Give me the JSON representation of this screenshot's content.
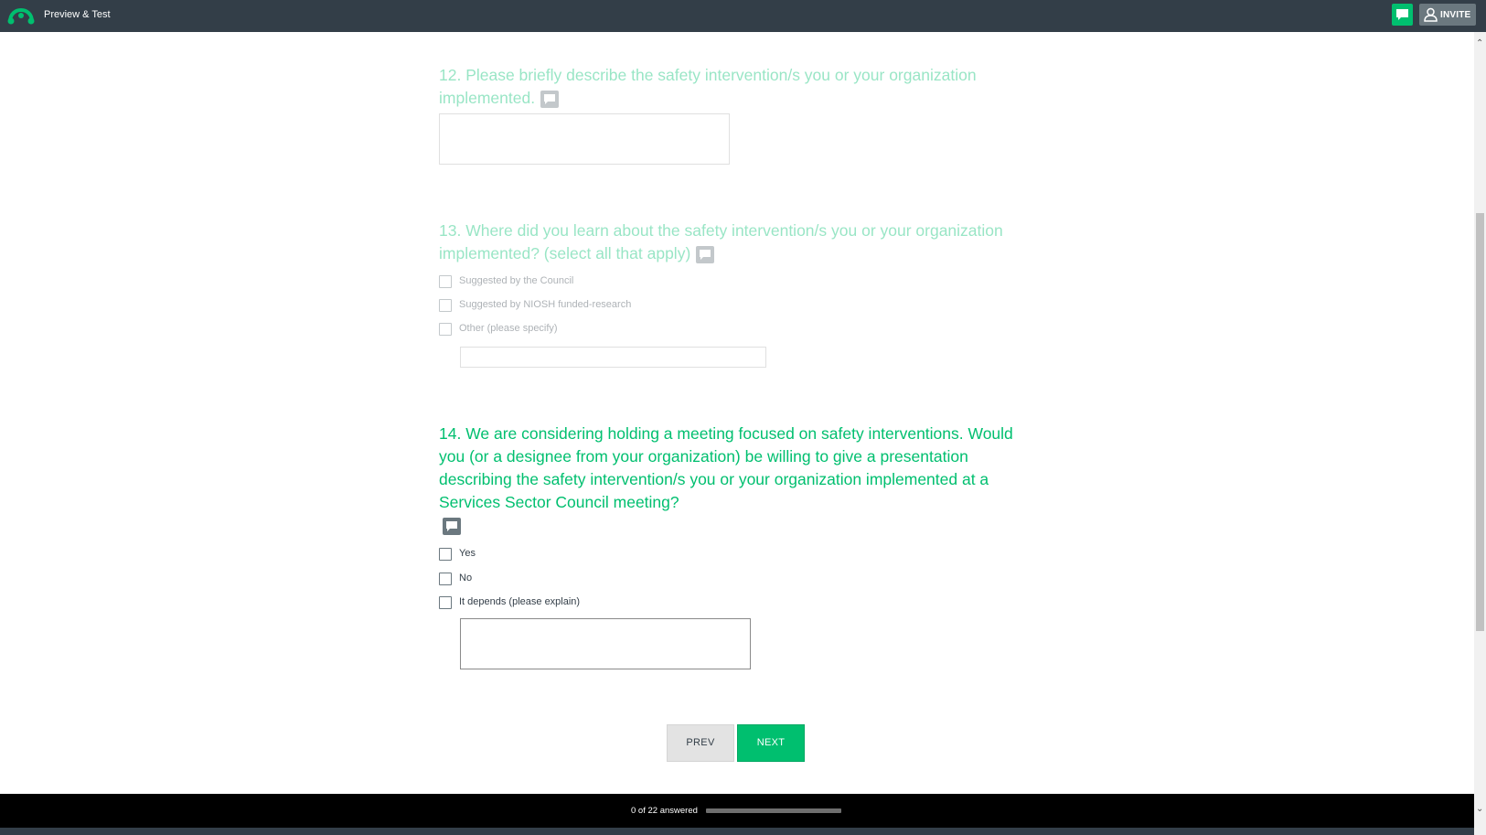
{
  "header": {
    "title": "Preview & Test",
    "invite_label": "INVITE",
    "logo_icon": "surveymonkey-logo-icon",
    "comment_icon": "comment-bubble-icon",
    "invite_icon": "user-icon"
  },
  "questions": [
    {
      "title": "12. Please briefly describe the safety intervention/s you or your organization implemented.",
      "input_value": ""
    },
    {
      "title": "13. Where did you learn about the safety intervention/s you or your organization implemented? (select all that apply)",
      "options": [
        {
          "label": "Suggested by the Council",
          "checked": false
        },
        {
          "label": "Suggested by NIOSH funded-research",
          "checked": false
        },
        {
          "label": "Other (please specify)",
          "checked": false
        }
      ],
      "other_value": ""
    },
    {
      "title": "14. We are considering holding a meeting focused on safety interventions.  Would you (or a designee from your organization) be willing to give a presentation describing the safety intervention/s you or your organization implemented at a Services Sector Council meeting?",
      "options": [
        {
          "label": "Yes",
          "checked": false
        },
        {
          "label": "No",
          "checked": false
        },
        {
          "label": "It depends (please explain)",
          "checked": false
        }
      ],
      "explain_value": ""
    }
  ],
  "nav": {
    "prev_label": "PREV",
    "next_label": "NEXT"
  },
  "footer": {
    "progress_text": "0 of 22 answered",
    "progress_fraction": 0
  },
  "colors": {
    "brand": "#00bf6f",
    "topbar": "#333e48",
    "icon_gray": "#6b787f"
  }
}
